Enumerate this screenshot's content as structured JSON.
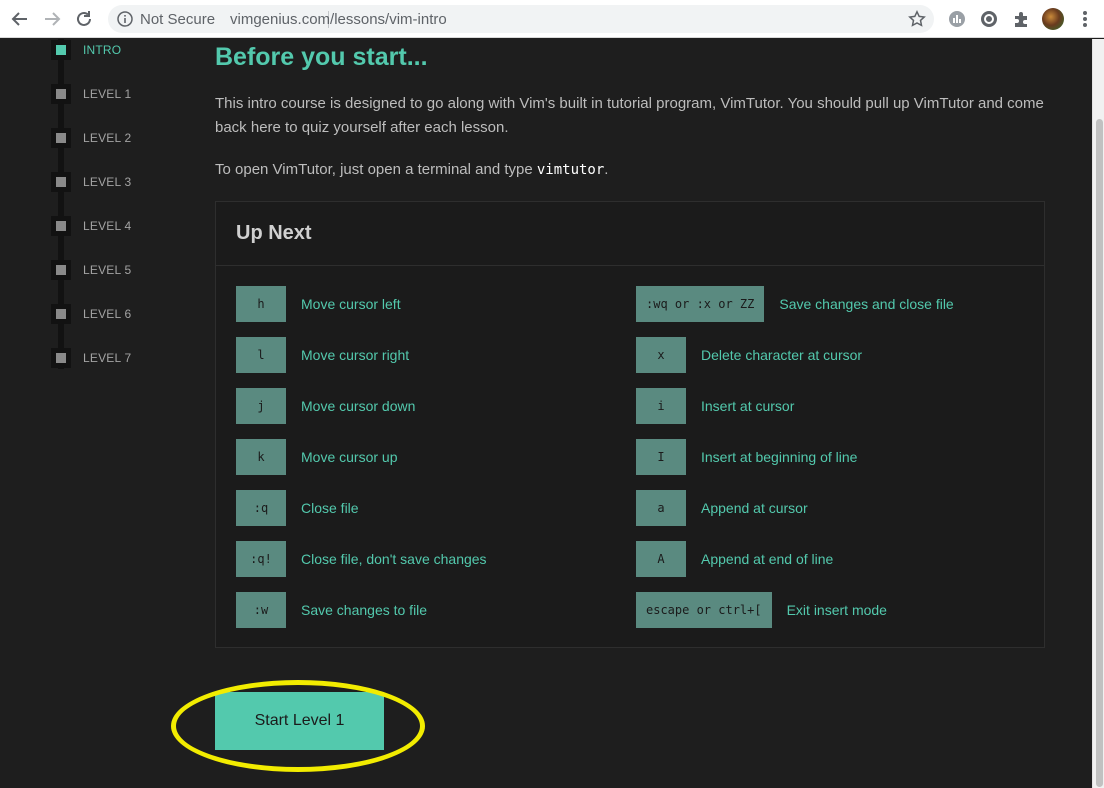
{
  "browser": {
    "security_label": "Not Secure",
    "url": "vimgenius.com/lessons/vim-intro"
  },
  "sidebar": {
    "items": [
      {
        "label": "INTRO",
        "active": true
      },
      {
        "label": "LEVEL 1",
        "active": false
      },
      {
        "label": "LEVEL 2",
        "active": false
      },
      {
        "label": "LEVEL 3",
        "active": false
      },
      {
        "label": "LEVEL 4",
        "active": false
      },
      {
        "label": "LEVEL 5",
        "active": false
      },
      {
        "label": "LEVEL 6",
        "active": false
      },
      {
        "label": "LEVEL 7",
        "active": false
      }
    ]
  },
  "main": {
    "title": "Before you start...",
    "intro_text": "This intro course is designed to go along with Vim's built in tutorial program, VimTutor. You should pull up VimTutor and come back here to quiz yourself after each lesson.",
    "open_text_before": "To open VimTutor, just open a terminal and type ",
    "open_text_code": "vimtutor",
    "open_text_after": "."
  },
  "up_next": {
    "heading": "Up Next",
    "left": [
      {
        "key": "h",
        "desc": "Move cursor left"
      },
      {
        "key": "l",
        "desc": "Move cursor right"
      },
      {
        "key": "j",
        "desc": "Move cursor down"
      },
      {
        "key": "k",
        "desc": "Move cursor up"
      },
      {
        "key": ":q",
        "desc": "Close file"
      },
      {
        "key": ":q!",
        "desc": "Close file, don't save changes"
      },
      {
        "key": ":w",
        "desc": "Save changes to file"
      }
    ],
    "right": [
      {
        "key": ":wq or :x or ZZ",
        "desc": "Save changes and close file"
      },
      {
        "key": "x",
        "desc": "Delete character at cursor"
      },
      {
        "key": "i",
        "desc": "Insert at cursor"
      },
      {
        "key": "I",
        "desc": "Insert at beginning of line"
      },
      {
        "key": "a",
        "desc": "Append at cursor"
      },
      {
        "key": "A",
        "desc": "Append at end of line"
      },
      {
        "key": "escape or ctrl+[",
        "desc": "Exit insert mode"
      }
    ]
  },
  "start_button": {
    "label": "Start Level 1"
  },
  "colors": {
    "accent": "#53c9ad",
    "key_bg": "#5a8a80",
    "highlight": "#f2ec00",
    "background": "#1e1e1e"
  }
}
